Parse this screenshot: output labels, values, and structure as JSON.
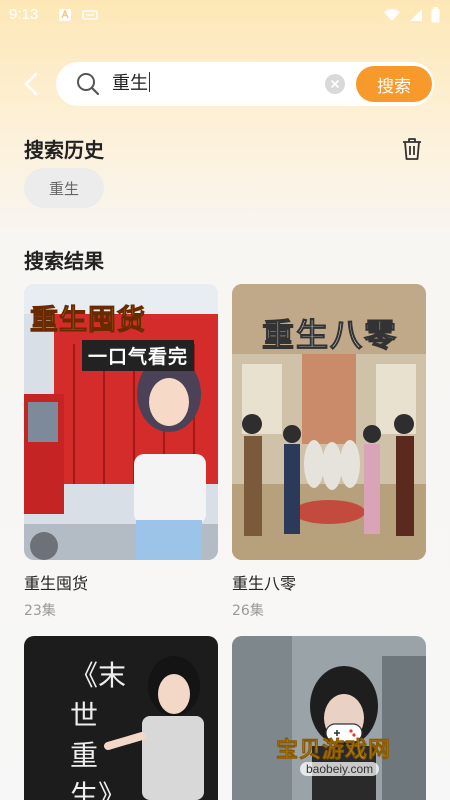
{
  "status_bar": {
    "time": "9:13"
  },
  "search": {
    "query": "重生",
    "button_label": "搜索"
  },
  "history": {
    "title": "搜索历史",
    "tags": [
      "重生"
    ]
  },
  "results": {
    "title": "搜索结果",
    "items": [
      {
        "cover_title": "重生囤货",
        "cover_subtitle": "一口气看完",
        "title": "重生囤货",
        "count": "23集"
      },
      {
        "cover_title": "重生八零",
        "title": "重生八零",
        "count": "26集"
      },
      {
        "cover_title": "《末世重生》"
      }
    ]
  },
  "watermark": {
    "name": "宝贝游戏网",
    "url": "baobeiy.com"
  },
  "colors": {
    "accent": "#f79a2b",
    "background_top": "#fde7b6"
  }
}
